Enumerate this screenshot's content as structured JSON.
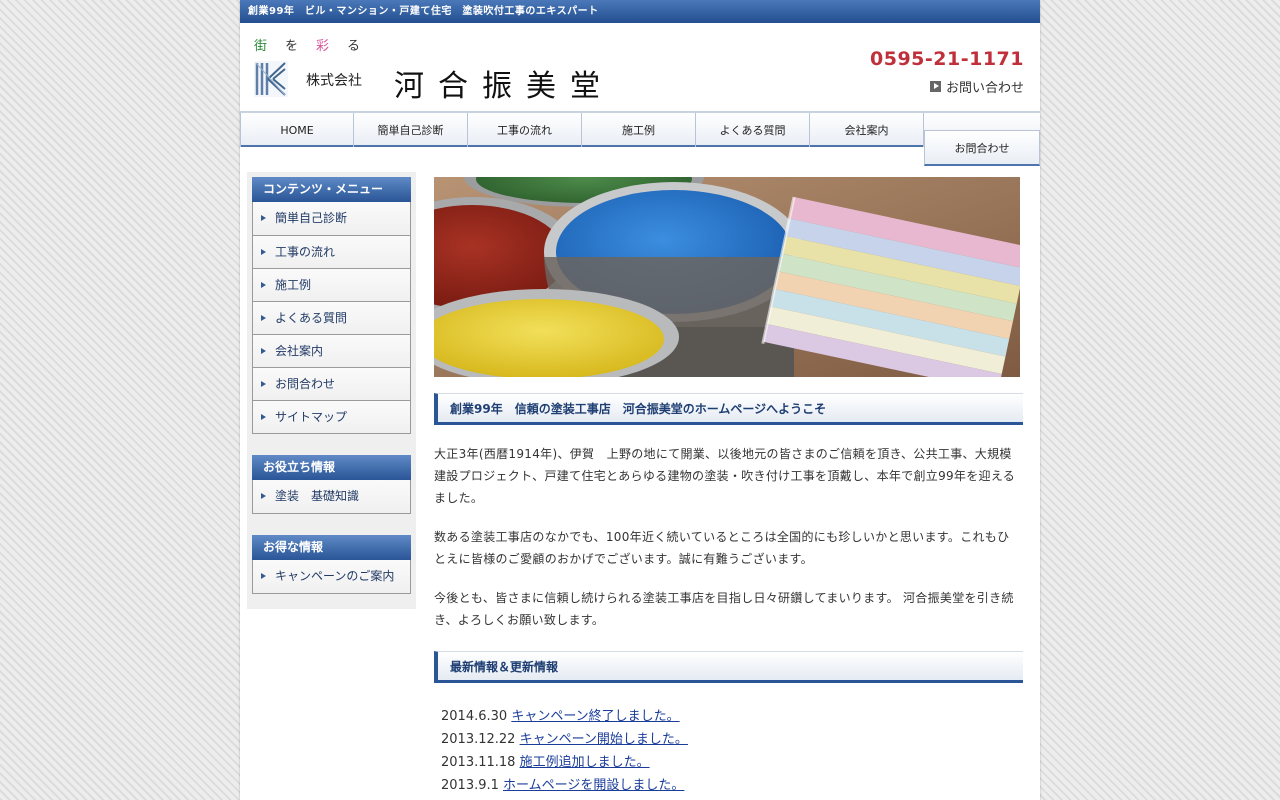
{
  "topbar": {
    "text": "創業99年　ビル・マンション・戸建て住宅　塗装吹付工事のエキスパート"
  },
  "header": {
    "tagline": [
      "街",
      "を",
      "彩",
      "る"
    ],
    "corp_type": "株式会社",
    "company_name": "河合振美堂",
    "phone": "0595-21-1171",
    "contact_link": "お問い合わせ"
  },
  "nav": {
    "items": [
      "HOME",
      "簡単自己診断",
      "工事の流れ",
      "施工例",
      "よくある質問",
      "会社案内"
    ],
    "contact": "お問合わせ"
  },
  "sidebar": {
    "blocks": [
      {
        "title": "コンテンツ・メニュー",
        "items": [
          "簡単自己診断",
          "工事の流れ",
          "施工例",
          "よくある質問",
          "会社案内",
          "お問合わせ",
          "サイトマップ"
        ]
      },
      {
        "title": "お役立ち情報",
        "items": [
          "塗装　基礎知識"
        ]
      },
      {
        "title": "お得な情報",
        "items": [
          "キャンペーンのご案内"
        ]
      }
    ]
  },
  "main": {
    "welcome_title": "創業99年　信頼の塗装工事店　河合振美堂のホームページへようこそ",
    "paragraphs": [
      "大正3年(西暦1914年)、伊賀　上野の地にて開業、以後地元の皆さまのご信頼を頂き、公共工事、大規模建設プロジェクト、戸建て住宅とあらゆる建物の塗装・吹き付け工事を頂戴し、本年で創立99年を迎えるました。",
      "数ある塗装工事店のなかでも、100年近く続いているところは全国的にも珍しいかと思います。これもひとえに皆様のご愛顧のおかげでございます。誠に有難うございます。",
      "今後とも、皆さまに信頼し続けられる塗装工事店を目指し日々研鑽してまいります。 河合振美堂を引き続き、よろしくお願い致します。"
    ],
    "news_title": "最新情報＆更新情報",
    "news": [
      {
        "date": "2014.6.30",
        "text": "キャンペーン終了しました。"
      },
      {
        "date": "2013.12.22",
        "text": "キャンペーン開始しました。"
      },
      {
        "date": "2013.11.18",
        "text": "施工例追加しました。"
      },
      {
        "date": "2013.9.1",
        "text": "ホームページを開設しました。"
      }
    ]
  },
  "colors": {
    "brand_blue": "#2a5597",
    "phone_red": "#c0303a",
    "link_blue": "#1a3d9a"
  }
}
